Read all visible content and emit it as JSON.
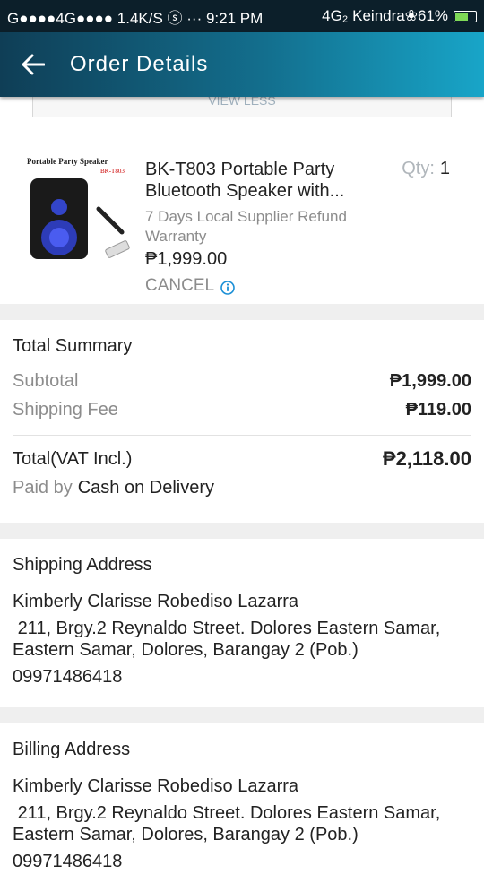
{
  "status_bar": {
    "left": "G●●●●4G●●●● 1.4K/S ⓢ ··· 9:21 PM",
    "right": "4G₂ Keindra❀61%"
  },
  "header": {
    "title": "Order Details"
  },
  "order": {
    "view_less": "VIEW LESS",
    "product_name": "BK-T803 Portable Party Bluetooth Speaker with...",
    "qty_label": "Qty:",
    "qty_value": "1",
    "warranty": "7 Days Local Supplier Refund Warranty",
    "price": "₱1,999.00",
    "status": "CANCEL",
    "thumb_caption": "Portable Party Speaker",
    "thumb_model": "BK-T803"
  },
  "summary": {
    "title": "Total Summary",
    "subtotal_label": "Subtotal",
    "subtotal_value": "₱1,999.00",
    "shipping_label": "Shipping Fee",
    "shipping_value": "₱119.00",
    "total_label": "Total(VAT Incl.)",
    "total_value": "₱2,118.00",
    "paid_by_label": "Paid by",
    "paid_by_value": "Cash on Delivery"
  },
  "shipping": {
    "title": "Shipping Address",
    "name": "Kimberly Clarisse Robediso Lazarra",
    "address": " 211, Brgy.2 Reynaldo Street. Dolores Eastern Samar, Eastern Samar, Dolores, Barangay 2 (Pob.)",
    "phone": "09971486418"
  },
  "billing": {
    "title": "Billing Address",
    "name": "Kimberly Clarisse Robediso Lazarra",
    "address": " 211, Brgy.2 Reynaldo Street. Dolores Eastern Samar, Eastern Samar, Dolores, Barangay 2 (Pob.)",
    "phone": "09971486418"
  }
}
